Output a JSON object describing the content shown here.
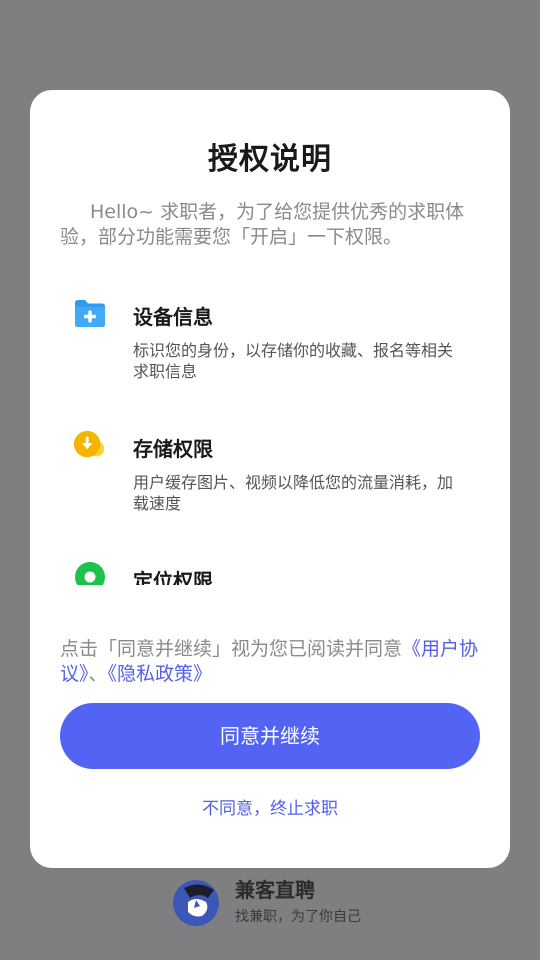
{
  "dialog": {
    "title": "授权说明",
    "intro": "Hello~ 求职者，为了给您提供优秀的求职体验，部分功能需要您「开启」一下权限。",
    "permissions": [
      {
        "icon": "folder-plus-icon",
        "title": "设备信息",
        "description": "标识您的身份，以存储你的收藏、报名等相关求职信息",
        "color": "#2f9bf0"
      },
      {
        "icon": "download-icon",
        "title": "存储权限",
        "description": "用户缓存图片、视频以降低您的流量消耗，加载速度",
        "color": "#f5b400"
      },
      {
        "icon": "location-icon",
        "title": "定位权限",
        "description": "",
        "color": "#1ec24a"
      }
    ],
    "agreement": {
      "prefix": "点击「同意并继续」视为您已阅读并同意",
      "user_agreement_link": "《用户协议》",
      "separator": "、",
      "privacy_policy_link": "《隐私政策》"
    },
    "agree_button": "同意并继续",
    "disagree_link": "不同意，终止求职",
    "accent_color": "#5363f4"
  },
  "brand": {
    "name": "兼客直聘",
    "slogan": "找兼职，为了你自己",
    "logo_icon": "shark-logo-icon"
  }
}
